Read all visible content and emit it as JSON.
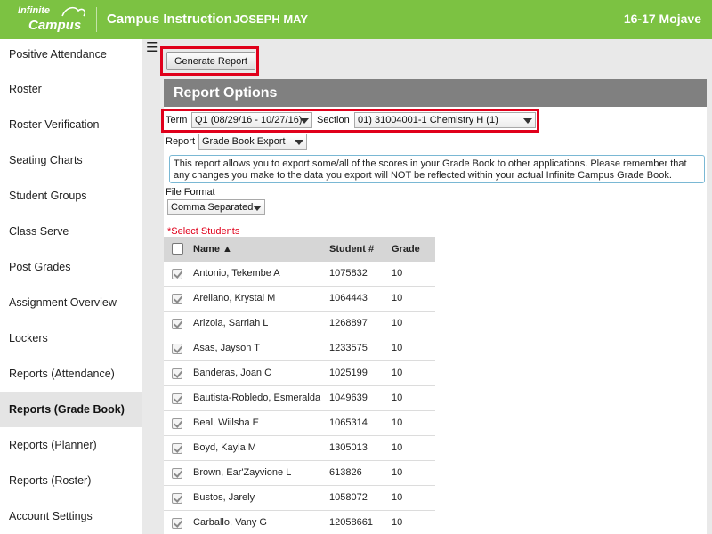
{
  "header": {
    "logo_top": "Infinite",
    "logo_bottom": "Campus",
    "app_title": "Campus Instruction",
    "user_name": "JOSEPH MAY",
    "year_school": "16-17 Mojave"
  },
  "sidebar": {
    "items": [
      {
        "label": "Positive Attendance"
      },
      {
        "label": "Roster"
      },
      {
        "label": "Roster Verification"
      },
      {
        "label": "Seating Charts"
      },
      {
        "label": "Student Groups"
      },
      {
        "label": "Class Serve"
      },
      {
        "label": "Post Grades"
      },
      {
        "label": "Assignment Overview"
      },
      {
        "label": "Lockers"
      },
      {
        "label": "Reports (Attendance)"
      },
      {
        "label": "Reports (Grade Book)",
        "active": true
      },
      {
        "label": "Reports (Planner)"
      },
      {
        "label": "Reports (Roster)"
      },
      {
        "label": "Account Settings"
      }
    ]
  },
  "toolbar": {
    "generate_label": "Generate Report"
  },
  "options": {
    "title": "Report Options",
    "term_label": "Term",
    "term_value": "Q1 (08/29/16 - 10/27/16)",
    "section_label": "Section",
    "section_value": "01) 31004001-1 Chemistry H (1)",
    "report_label": "Report",
    "report_value": "Grade Book Export",
    "info_text": "This report allows you to export some/all of the scores in your Grade Book to other applications. Please remember that any changes you make to the data you export will NOT be reflected within your actual Infinite Campus Grade Book.",
    "file_format_label": "File Format",
    "file_format_value": "Comma Separated",
    "select_students_label": "*Select Students"
  },
  "table": {
    "headers": {
      "name": "Name",
      "student_num": "Student #",
      "grade": "Grade"
    },
    "sort_indicator": "▲",
    "rows": [
      {
        "name": "Antonio, Tekembe A",
        "student_num": "1075832",
        "grade": "10",
        "checked": true
      },
      {
        "name": "Arellano, Krystal M",
        "student_num": "1064443",
        "grade": "10",
        "checked": true
      },
      {
        "name": "Arizola, Sarriah L",
        "student_num": "1268897",
        "grade": "10",
        "checked": true
      },
      {
        "name": "Asas, Jayson T",
        "student_num": "1233575",
        "grade": "10",
        "checked": true
      },
      {
        "name": "Banderas, Joan C",
        "student_num": "1025199",
        "grade": "10",
        "checked": true
      },
      {
        "name": "Bautista-Robledo, Esmeralda",
        "student_num": "1049639",
        "grade": "10",
        "checked": true
      },
      {
        "name": "Beal, Wiilsha E",
        "student_num": "1065314",
        "grade": "10",
        "checked": true
      },
      {
        "name": "Boyd, Kayla M",
        "student_num": "1305013",
        "grade": "10",
        "checked": true
      },
      {
        "name": "Brown, Ear'Zayvione L",
        "student_num": "613826",
        "grade": "10",
        "checked": true
      },
      {
        "name": "Bustos, Jarely",
        "student_num": "1058072",
        "grade": "10",
        "checked": true
      },
      {
        "name": "Carballo, Vany G",
        "student_num": "12058661",
        "grade": "10",
        "checked": true
      }
    ]
  },
  "colors": {
    "brand_green": "#7cc242",
    "highlight_red": "#e0001b",
    "options_bar": "#808080"
  }
}
